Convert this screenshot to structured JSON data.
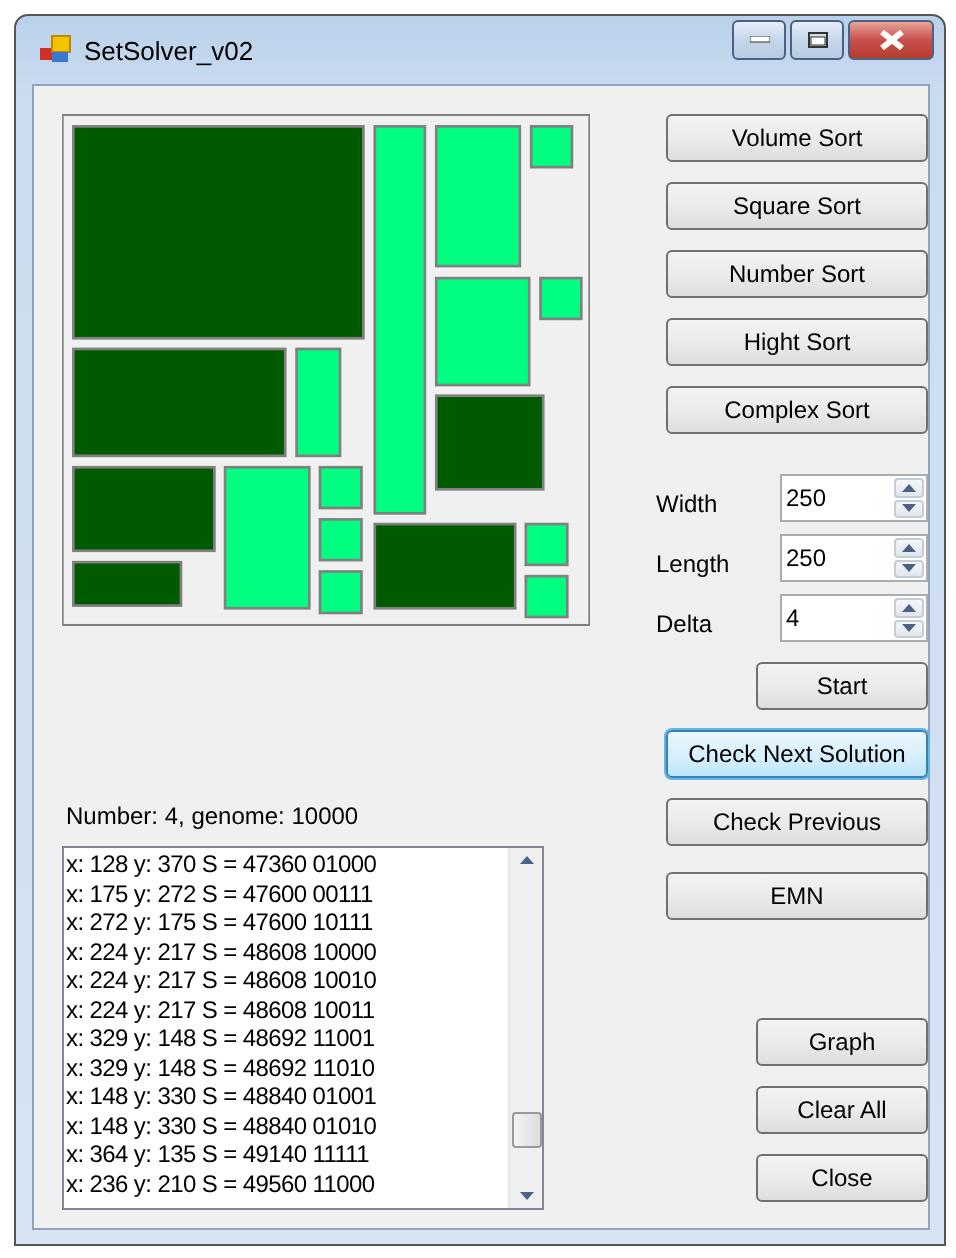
{
  "window": {
    "title": "SetSolver_v02"
  },
  "sort_buttons": [
    "Volume Sort",
    "Square Sort",
    "Number Sort",
    "Hight Sort",
    "Complex Sort"
  ],
  "parameters": [
    {
      "label": "Width",
      "value": "250"
    },
    {
      "label": "Length",
      "value": "250"
    },
    {
      "label": "Delta",
      "value": "4"
    }
  ],
  "actions": [
    {
      "label": "Start",
      "focused": false
    },
    {
      "label": "Check Next Solution",
      "focused": true
    },
    {
      "label": "Check Previous",
      "focused": false
    },
    {
      "label": "EMN",
      "focused": false
    }
  ],
  "status": "Number: 4, genome: 10000",
  "log": [
    "x: 128 y: 370 S = 47360 01000",
    "x: 175 y: 272 S = 47600 00111",
    "x: 272 y: 175 S = 47600 10111",
    "x: 224 y: 217 S = 48608 10000",
    "x: 224 y: 217 S = 48608 10010",
    "x: 224 y: 217 S = 48608 10011",
    "x: 329 y: 148 S = 48692 11001",
    "x: 329 y: 148 S = 48692 11010",
    "x: 148 y: 330 S = 48840 01001",
    "x: 148 y: 330 S = 48840 01010",
    "x: 364 y: 135 S = 49140 11111",
    "x: 236 y: 210 S = 49560 11000"
  ],
  "bottom_buttons": [
    "Graph",
    "Clear All",
    "Close"
  ]
}
